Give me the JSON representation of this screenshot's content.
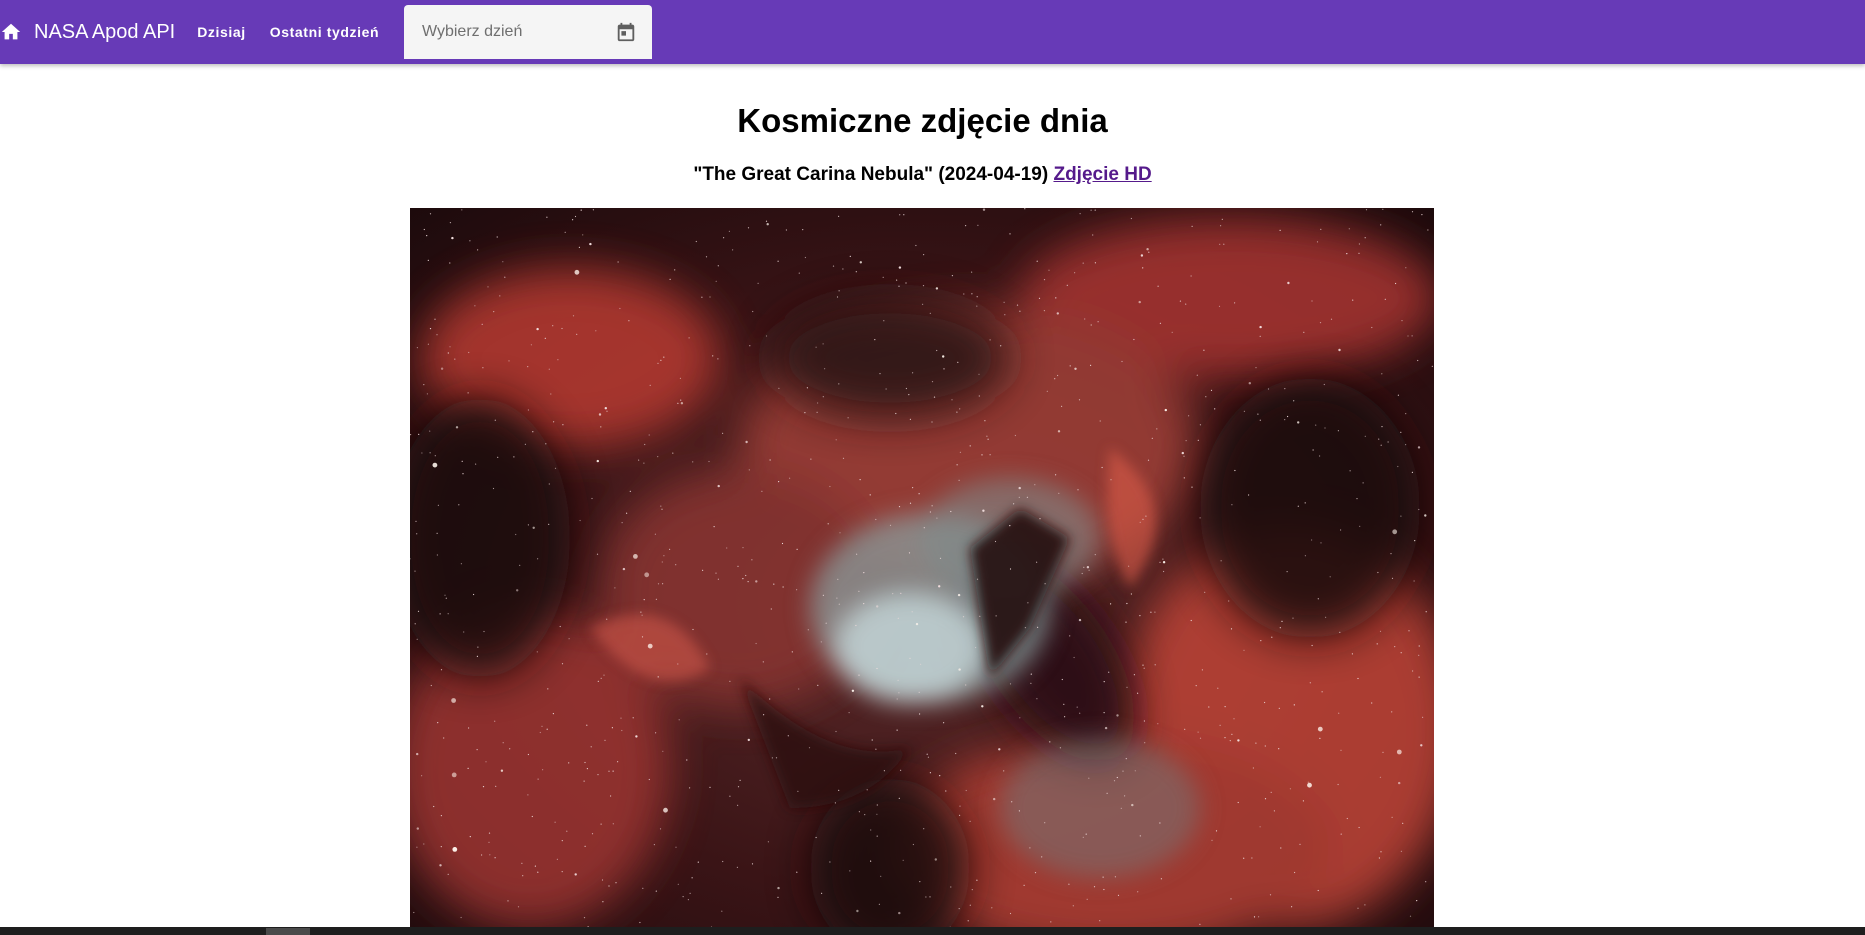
{
  "toolbar": {
    "home_icon": "home-icon",
    "brand": "NASA Apod API",
    "nav": [
      {
        "label": "Dzisiaj"
      },
      {
        "label": "Ostatni tydzień"
      }
    ],
    "date_picker": {
      "placeholder": "Wybierz dzień",
      "value": "",
      "icon": "calendar-icon"
    },
    "color": "#673ab7"
  },
  "main": {
    "title": "Kosmiczne zdjęcie dnia",
    "picture_title": "\"The Great Carina Nebula\" (2024-04-19)",
    "hd_link": "Zdjęcie HD",
    "link_color": "#551a8b"
  }
}
